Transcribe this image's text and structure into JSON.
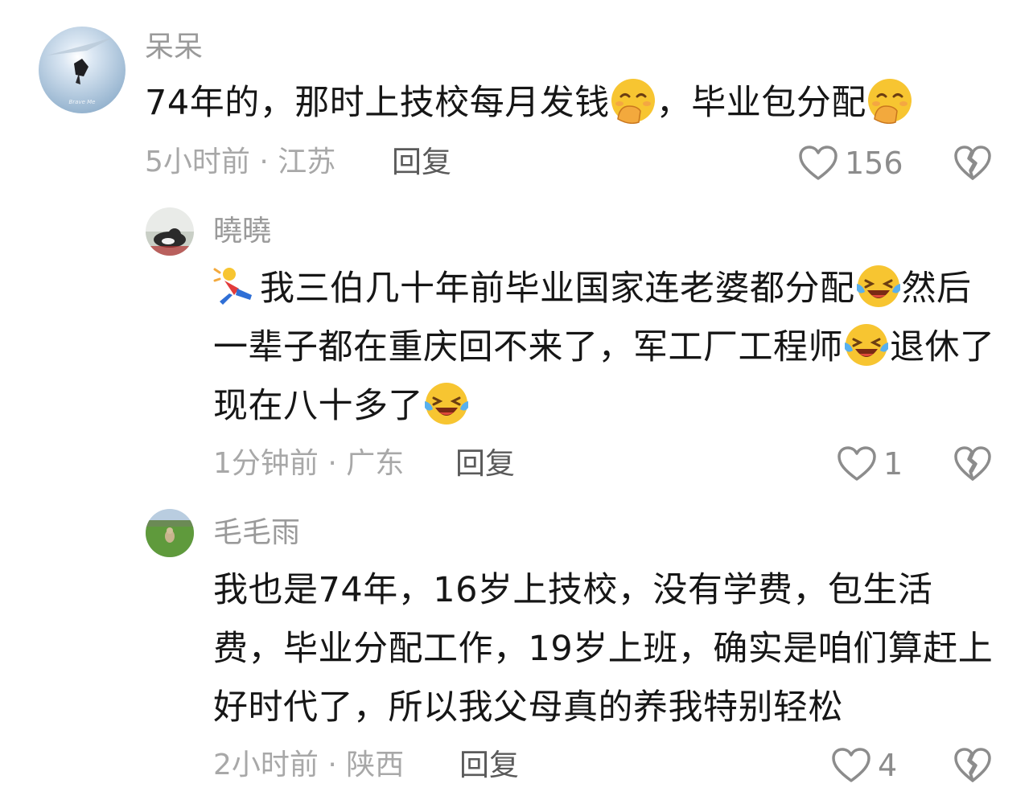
{
  "colors": {
    "username": "#9a9a9a",
    "body_text": "#161616",
    "meta": "#a8a8a8",
    "reply": "#5a5a5a",
    "icon": "#8c8c8c"
  },
  "comments": [
    {
      "username": "呆呆",
      "avatar": "avatar-sky-photo",
      "avatar_caption": "Brave Me",
      "segments": [
        {
          "t": "74年的，那时上技校每月发钱"
        },
        {
          "emoji": "covering-mouth-emoji"
        },
        {
          "t": "，毕业包分配"
        },
        {
          "emoji": "covering-mouth-emoji"
        }
      ],
      "meta": "5小时前 · 江苏",
      "reply_label": "回复",
      "like_count": "156",
      "like_icon": "heart-outline-icon",
      "dislike_icon": "broken-heart-icon"
    },
    {
      "username": "曉曉",
      "avatar": "avatar-cat-photo",
      "segments": [
        {
          "emoji": "falling-person-emoji"
        },
        {
          "t": "我三伯几十年前毕业国家连老婆都分配"
        },
        {
          "emoji": "crying-laughing-emoji"
        },
        {
          "t": "然后一辈子都在重庆回不来了，军工厂工程师"
        },
        {
          "emoji": "crying-laughing-emoji"
        },
        {
          "t": "退休了现在八十多了"
        },
        {
          "emoji": "crying-laughing-emoji"
        }
      ],
      "meta": "1分钟前 · 广东",
      "reply_label": "回复",
      "like_count": "1",
      "like_icon": "heart-outline-icon",
      "dislike_icon": "broken-heart-icon"
    },
    {
      "username": "毛毛雨",
      "avatar": "avatar-dog-grass-photo",
      "segments": [
        {
          "t": "我也是74年，16岁上技校，没有学费，包生活费，毕业分配工作，19岁上班，确实是咱们算赶上好时代了，所以我父母真的养我特别轻松"
        }
      ],
      "meta": "2小时前 · 陕西",
      "reply_label": "回复",
      "like_count": "4",
      "like_icon": "heart-outline-icon",
      "dislike_icon": "broken-heart-icon"
    }
  ]
}
